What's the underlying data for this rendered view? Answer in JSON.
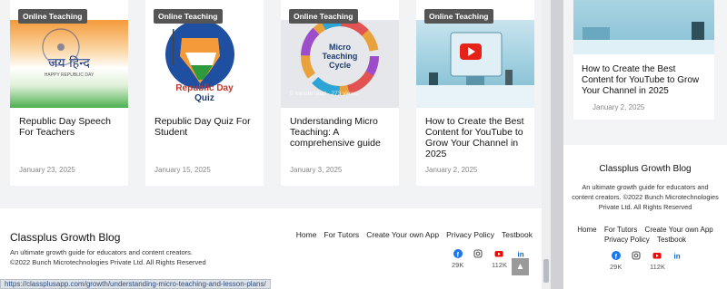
{
  "main": {
    "cards": [
      {
        "badge": "Online Teaching",
        "title": "Republic Day Speech For Teachers",
        "date": "January 23, 2025",
        "image_caption": "जय हिन्द",
        "image_sub": "HAPPY REPUBLIC DAY"
      },
      {
        "badge": "Online Teaching",
        "title": "Republic Day Quiz For Student",
        "date": "January 15, 2025",
        "image_caption_1": "Republic Day",
        "image_caption_2": "Quiz"
      },
      {
        "badge": "Online Teaching",
        "title": "Understanding Micro Teaching: A comprehensive guide",
        "date": "January 3, 2025",
        "image_caption": "Micro Teaching Cycle",
        "image_overlay": "5 minute read · 273 views"
      },
      {
        "badge": "Online Teaching",
        "title": "How to Create the Best Content for YouTube to Grow Your Channel in 2025",
        "date": "January 2, 2025"
      }
    ],
    "footer": {
      "brand": "Classplus Growth Blog",
      "description_line1": "An ultimate growth guide for educators and content creators.",
      "description_line2": "©2022 Bunch Microtechnologies Private Ltd. All Rights Reserved",
      "nav": [
        "Home",
        "For Tutors",
        "Create Your own App",
        "Privacy Policy",
        "Testbook"
      ],
      "social": [
        {
          "icon": "facebook-icon",
          "count": "29K",
          "color": "#1877f2"
        },
        {
          "icon": "instagram-icon",
          "count": "",
          "color": "#555555"
        },
        {
          "icon": "youtube-icon",
          "count": "112K",
          "color": "#ff0000"
        },
        {
          "icon": "linkedin-icon",
          "count": "",
          "color": "#0a66c2"
        }
      ],
      "scroll_top_icon": "▲"
    },
    "status_url": "https://classplusapp.com/growth/understanding-micro-teaching-and-lesson-plans/"
  },
  "right": {
    "card": {
      "title": "How to Create the Best Content for YouTube to Grow Your Channel in 2025",
      "date": "January 2, 2025"
    },
    "footer": {
      "brand": "Classplus Growth Blog",
      "description": "An ultimate growth guide for educators and content creators. ©2022 Bunch Microtechnologies Private Ltd. All Rights Reserved",
      "nav": [
        "Home",
        "For Tutors",
        "Create Your own App",
        "Privacy Policy",
        "Testbook"
      ],
      "social": [
        {
          "icon": "facebook-icon",
          "count": "29K"
        },
        {
          "icon": "instagram-icon",
          "count": ""
        },
        {
          "icon": "youtube-icon",
          "count": "112K"
        },
        {
          "icon": "linkedin-icon",
          "count": ""
        }
      ]
    }
  }
}
